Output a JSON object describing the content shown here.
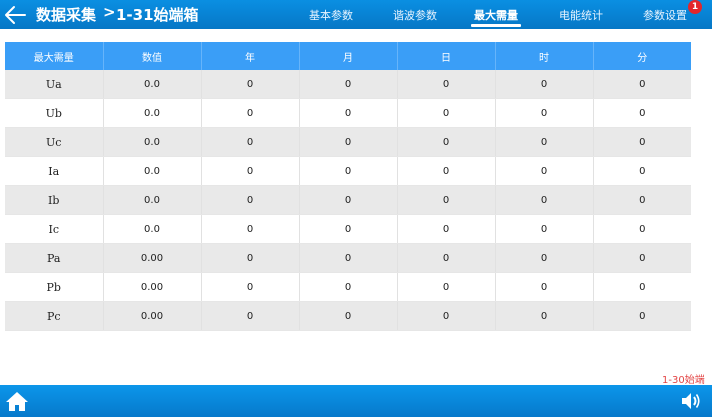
{
  "header": {
    "title": "数据采集",
    "separator": ">",
    "subtitle": "1-31始端箱",
    "tabs": [
      {
        "label": "基本参数"
      },
      {
        "label": "谐波参数"
      },
      {
        "label": "最大需量",
        "active": true
      },
      {
        "label": "电能统计"
      },
      {
        "label": "参数设置"
      }
    ],
    "badge_count": "1"
  },
  "table": {
    "columns": [
      "最大需量",
      "数值",
      "年",
      "月",
      "日",
      "时",
      "分"
    ],
    "rows": [
      [
        "Ua",
        "0.0",
        "0",
        "0",
        "0",
        "0",
        "0"
      ],
      [
        "Ub",
        "0.0",
        "0",
        "0",
        "0",
        "0",
        "0"
      ],
      [
        "Uc",
        "0.0",
        "0",
        "0",
        "0",
        "0",
        "0"
      ],
      [
        "Ia",
        "0.0",
        "0",
        "0",
        "0",
        "0",
        "0"
      ],
      [
        "Ib",
        "0.0",
        "0",
        "0",
        "0",
        "0",
        "0"
      ],
      [
        "Ic",
        "0.0",
        "0",
        "0",
        "0",
        "0",
        "0"
      ],
      [
        "Pa",
        "0.00",
        "0",
        "0",
        "0",
        "0",
        "0"
      ],
      [
        "Pb",
        "0.00",
        "0",
        "0",
        "0",
        "0",
        "0"
      ],
      [
        "Pc",
        "0.00",
        "0",
        "0",
        "0",
        "0",
        "0"
      ]
    ]
  },
  "side_note": "1-30始端",
  "footer": {
    "home_icon": "home-icon",
    "speaker_icon": "speaker-icon"
  },
  "colors": {
    "header_blue": "#0a8fe2",
    "table_header_blue": "#3a9ef7",
    "row_gray": "#e9e9e9",
    "badge_red": "#e3262b",
    "note_red": "#e34646"
  }
}
